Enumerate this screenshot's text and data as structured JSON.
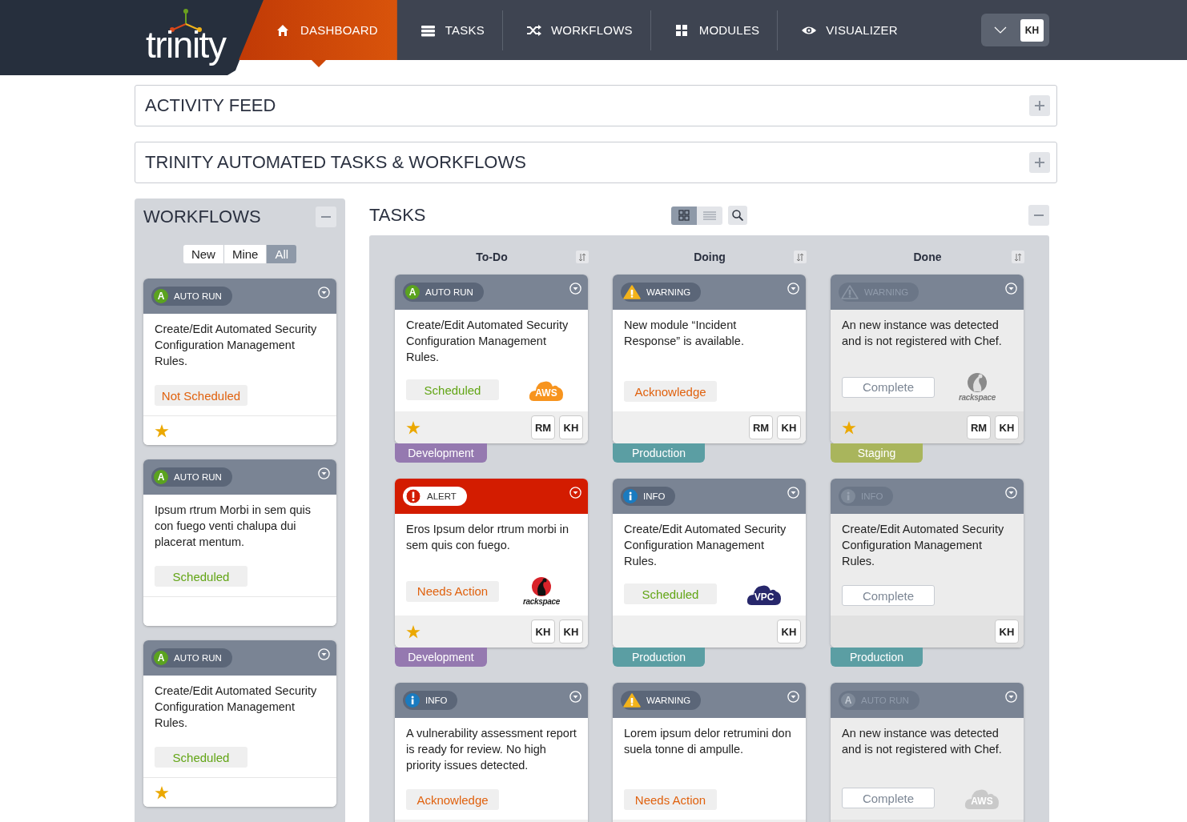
{
  "brand": {
    "name": "trinity"
  },
  "nav": [
    {
      "label": "DASHBOARD",
      "kind": "home",
      "selected": true
    },
    {
      "label": "TASKS",
      "kind": "list",
      "selected": false
    },
    {
      "label": "WORKFLOWS",
      "kind": "shuffle",
      "selected": false
    },
    {
      "label": "MODULES",
      "kind": "grid",
      "selected": false
    },
    {
      "label": "VISUALIZER",
      "kind": "eye",
      "selected": false
    }
  ],
  "user": {
    "initials": "KH"
  },
  "sections": [
    {
      "title": "ACTIVITY FEED",
      "expanded": false
    },
    {
      "title": "TRINITY AUTOMATED TASKS & WORKFLOWS",
      "expanded": false
    }
  ],
  "workflows": {
    "title": "WORKFLOWS",
    "expanded": true,
    "filters": [
      {
        "label": "New",
        "selected": false
      },
      {
        "label": "Mine",
        "selected": false
      },
      {
        "label": "All",
        "selected": true
      }
    ],
    "cards": [
      {
        "badge": {
          "kind": "autorun",
          "symbol": "A",
          "label": "AUTO RUN"
        },
        "text": "Create/Edit Automated Security Configuration Management Rules.",
        "action": {
          "kind": "negative",
          "label": "Not Scheduled"
        },
        "starred": true
      },
      {
        "badge": {
          "kind": "autorun",
          "symbol": "A",
          "label": "AUTO RUN"
        },
        "text": "Ipsum rtrum Morbi in sem quis con fuego venti chalupa dui placerat mentum.",
        "action": {
          "kind": "positive",
          "label": "Scheduled"
        },
        "starred": false
      },
      {
        "badge": {
          "kind": "autorun",
          "symbol": "A",
          "label": "AUTO RUN"
        },
        "text": "Create/Edit Automated Security Configuration Management Rules.",
        "action": {
          "kind": "positive",
          "label": "Scheduled"
        },
        "starred": true
      }
    ]
  },
  "tasks": {
    "title": "TASKS",
    "expanded": true,
    "views": [
      {
        "kind": "grid",
        "selected": true
      },
      {
        "kind": "list",
        "selected": false
      }
    ],
    "columns": [
      {
        "title": "To-Do",
        "cards": [
          {
            "badge": {
              "kind": "autorun",
              "symbol": "A",
              "label": "AUTO RUN"
            },
            "muted": false,
            "text": "Create/Edit Automated Security Configuration Management Rules.",
            "action": {
              "kind": "positive",
              "label": "Scheduled"
            },
            "provider": {
              "kind": "aws",
              "label": "AWS"
            },
            "starred": true,
            "assignees": [
              "RM",
              "KH"
            ],
            "environment": {
              "label": "Development",
              "color": "#9579b0"
            }
          },
          {
            "badge": {
              "kind": "alert",
              "label": "ALERT"
            },
            "muted": false,
            "text": "Eros Ipsum delor rtrum morbi in sem quis con fuego.",
            "action": {
              "kind": "negative",
              "label": "Needs Action"
            },
            "provider": {
              "kind": "rackspace",
              "label": "rackspace"
            },
            "starred": true,
            "assignees": [
              "KH",
              "KH"
            ],
            "environment": {
              "label": "Development",
              "color": "#9579b0"
            }
          },
          {
            "badge": {
              "kind": "info",
              "label": "INFO"
            },
            "muted": false,
            "text": "A vulnerability assessment report is ready for review. No high priority issues detected.",
            "action": {
              "kind": "negative",
              "label": "Acknowledge"
            }
          }
        ]
      },
      {
        "title": "Doing",
        "cards": [
          {
            "badge": {
              "kind": "warning",
              "label": "WARNING"
            },
            "muted": false,
            "text": "New module “Incident Response” is available.",
            "action": {
              "kind": "negative",
              "label": "Acknowledge"
            },
            "starred": false,
            "assignees": [
              "RM",
              "KH"
            ],
            "environment": {
              "label": "Production",
              "color": "#5b9ea3"
            }
          },
          {
            "badge": {
              "kind": "info",
              "label": "INFO"
            },
            "muted": false,
            "text": "Create/Edit Automated Security Configuration Management Rules.",
            "action": {
              "kind": "positive",
              "label": "Scheduled"
            },
            "provider": {
              "kind": "vpc",
              "label": "VPC"
            },
            "starred": false,
            "assignees": [
              "KH"
            ],
            "environment": {
              "label": "Production",
              "color": "#5b9ea3"
            }
          },
          {
            "badge": {
              "kind": "warning",
              "label": "WARNING"
            },
            "muted": false,
            "text": "Lorem ipsum delor retrumini don suela tonne di ampulle.",
            "action": {
              "kind": "negative",
              "label": "Needs Action"
            }
          }
        ]
      },
      {
        "title": "Done",
        "cards": [
          {
            "badge": {
              "kind": "warning",
              "label": "WARNING"
            },
            "muted": true,
            "text": "An new instance was detected and is not registered with Chef.",
            "action": {
              "kind": "complete",
              "label": "Complete"
            },
            "provider": {
              "kind": "rackspace",
              "label": "rackspace"
            },
            "starred": true,
            "assignees": [
              "RM",
              "KH"
            ],
            "environment": {
              "label": "Staging",
              "color": "#a9b55c"
            }
          },
          {
            "badge": {
              "kind": "info",
              "label": "INFO"
            },
            "muted": true,
            "text": "Create/Edit Automated Security Configuration Management Rules.",
            "action": {
              "kind": "complete",
              "label": "Complete"
            },
            "starred": false,
            "assignees": [
              "KH"
            ],
            "environment": {
              "label": "Production",
              "color": "#5b9ea3"
            }
          },
          {
            "badge": {
              "kind": "autorun",
              "symbol": "A",
              "label": "AUTO RUN"
            },
            "muted": true,
            "text": "An new instance was detected and is not registered with Chef.",
            "action": {
              "kind": "complete",
              "label": "Complete"
            },
            "provider": {
              "kind": "aws",
              "label": "AWS"
            }
          }
        ]
      }
    ]
  }
}
